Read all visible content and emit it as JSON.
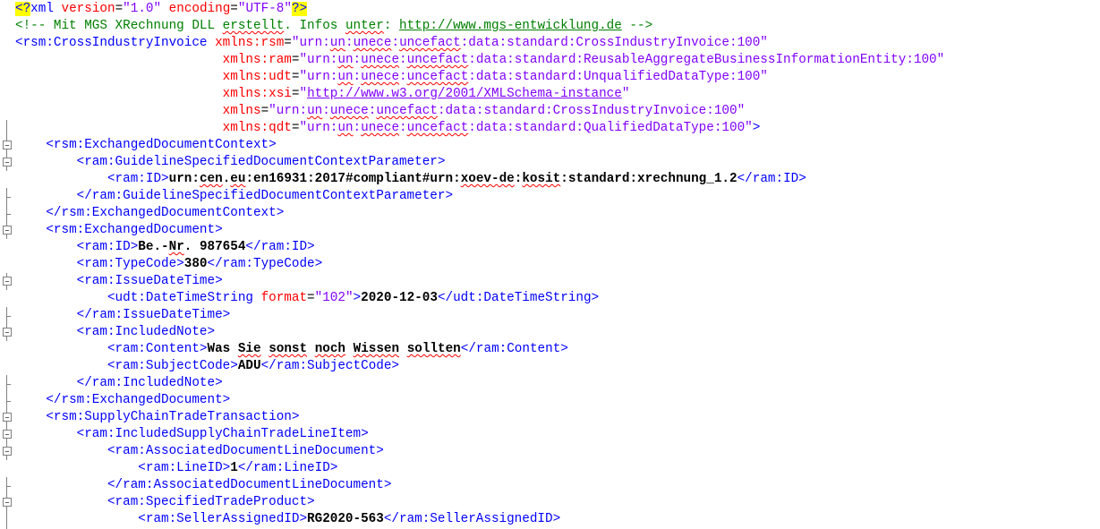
{
  "editor": {
    "language": "xml",
    "colors": {
      "tag": "#0000ff",
      "attribute": "#ff0000",
      "attribute_value": "#8000ff",
      "text": "#000000",
      "comment": "#008000",
      "processing_instruction_highlight": "#ffff00"
    },
    "lines": [
      {
        "indent": "",
        "segs": [
          {
            "t": "<?",
            "c": "c-bracket pi-hl"
          },
          {
            "t": "xml ",
            "c": "c-tag"
          },
          {
            "t": "version",
            "c": "c-attr"
          },
          {
            "t": "=",
            "c": "c-eq"
          },
          {
            "t": "\"1.0\"",
            "c": "c-str"
          },
          {
            "t": " ",
            "c": "c-plain"
          },
          {
            "t": "encoding",
            "c": "c-attr"
          },
          {
            "t": "=",
            "c": "c-eq"
          },
          {
            "t": "\"UTF-8\"",
            "c": "c-str"
          },
          {
            "t": "?>",
            "c": "c-bracket pi-hl"
          }
        ]
      },
      {
        "indent": "",
        "segs": [
          {
            "t": "<!-- Mit MGS XRechnung DLL ",
            "c": "c-comment"
          },
          {
            "t": "erstellt",
            "c": "c-comment sq"
          },
          {
            "t": ". Infos ",
            "c": "c-comment"
          },
          {
            "t": "unter",
            "c": "c-comment sq"
          },
          {
            "t": ": ",
            "c": "c-comment"
          },
          {
            "t": "http://www.mgs-entwicklung.de",
            "c": "c-comment link"
          },
          {
            "t": " -->",
            "c": "c-comment"
          }
        ]
      },
      {
        "indent": "",
        "segs": [
          {
            "t": "<rsm:CrossIndustryInvoice ",
            "c": "c-tag"
          },
          {
            "t": "xmlns:rsm",
            "c": "c-attr"
          },
          {
            "t": "=",
            "c": "c-eq"
          },
          {
            "t": "\"urn:",
            "c": "c-str"
          },
          {
            "t": "un",
            "c": "c-str sq"
          },
          {
            "t": ":",
            "c": "c-str"
          },
          {
            "t": "unece",
            "c": "c-str sq"
          },
          {
            "t": ":",
            "c": "c-str"
          },
          {
            "t": "uncefact",
            "c": "c-str sq"
          },
          {
            "t": ":data:standard:CrossIndustryInvoice:100\"",
            "c": "c-str"
          }
        ]
      },
      {
        "indent": "                           ",
        "segs": [
          {
            "t": "xmlns:ram",
            "c": "c-attr"
          },
          {
            "t": "=",
            "c": "c-eq"
          },
          {
            "t": "\"urn:",
            "c": "c-str"
          },
          {
            "t": "un",
            "c": "c-str sq"
          },
          {
            "t": ":",
            "c": "c-str"
          },
          {
            "t": "unece",
            "c": "c-str sq"
          },
          {
            "t": ":",
            "c": "c-str"
          },
          {
            "t": "uncefact",
            "c": "c-str sq"
          },
          {
            "t": ":data:standard:ReusableAggregateBusinessInformationEntity:100\"",
            "c": "c-str"
          }
        ]
      },
      {
        "indent": "                           ",
        "segs": [
          {
            "t": "xmlns:udt",
            "c": "c-attr"
          },
          {
            "t": "=",
            "c": "c-eq"
          },
          {
            "t": "\"urn:",
            "c": "c-str"
          },
          {
            "t": "un",
            "c": "c-str sq"
          },
          {
            "t": ":",
            "c": "c-str"
          },
          {
            "t": "unece",
            "c": "c-str sq"
          },
          {
            "t": ":",
            "c": "c-str"
          },
          {
            "t": "uncefact",
            "c": "c-str sq"
          },
          {
            "t": ":data:standard:UnqualifiedDataType:100\"",
            "c": "c-str"
          }
        ]
      },
      {
        "indent": "                           ",
        "segs": [
          {
            "t": "xmlns:xsi",
            "c": "c-attr"
          },
          {
            "t": "=",
            "c": "c-eq"
          },
          {
            "t": "\"",
            "c": "c-str"
          },
          {
            "t": "http://www.w3.org/2001/XMLSchema-instance",
            "c": "c-str link"
          },
          {
            "t": "\"",
            "c": "c-str"
          }
        ]
      },
      {
        "indent": "                           ",
        "segs": [
          {
            "t": "xmlns",
            "c": "c-attr"
          },
          {
            "t": "=",
            "c": "c-eq"
          },
          {
            "t": "\"urn:",
            "c": "c-str"
          },
          {
            "t": "un",
            "c": "c-str sq"
          },
          {
            "t": ":",
            "c": "c-str"
          },
          {
            "t": "unece",
            "c": "c-str sq"
          },
          {
            "t": ":",
            "c": "c-str"
          },
          {
            "t": "uncefact",
            "c": "c-str sq"
          },
          {
            "t": ":data:standard:CrossIndustryInvoice:100\"",
            "c": "c-str"
          }
        ]
      },
      {
        "indent": "                           ",
        "segs": [
          {
            "t": "xmlns:qdt",
            "c": "c-attr"
          },
          {
            "t": "=",
            "c": "c-eq"
          },
          {
            "t": "\"urn:",
            "c": "c-str"
          },
          {
            "t": "un",
            "c": "c-str sq"
          },
          {
            "t": ":",
            "c": "c-str"
          },
          {
            "t": "unece",
            "c": "c-str sq"
          },
          {
            "t": ":",
            "c": "c-str"
          },
          {
            "t": "uncefact",
            "c": "c-str sq"
          },
          {
            "t": ":data:standard:QualifiedDataType:100\"",
            "c": "c-str"
          },
          {
            "t": ">",
            "c": "c-tag"
          }
        ]
      },
      {
        "indent": "    ",
        "segs": [
          {
            "t": "<rsm:ExchangedDocumentContext>",
            "c": "c-tag"
          }
        ]
      },
      {
        "indent": "        ",
        "segs": [
          {
            "t": "<ram:GuidelineSpecifiedDocumentContextParameter>",
            "c": "c-tag"
          }
        ]
      },
      {
        "indent": "            ",
        "segs": [
          {
            "t": "<ram:ID>",
            "c": "c-tag"
          },
          {
            "t": "urn:",
            "c": "c-text"
          },
          {
            "t": "cen",
            "c": "c-text sq"
          },
          {
            "t": ".",
            "c": "c-text"
          },
          {
            "t": "eu",
            "c": "c-text sq"
          },
          {
            "t": ":en16931:2017#compliant#urn:",
            "c": "c-text"
          },
          {
            "t": "xoev-de",
            "c": "c-text sq"
          },
          {
            "t": ":",
            "c": "c-text"
          },
          {
            "t": "kosit",
            "c": "c-text sq"
          },
          {
            "t": ":standard:xrechnung_1.2",
            "c": "c-text"
          },
          {
            "t": "</ram:ID>",
            "c": "c-tag"
          }
        ]
      },
      {
        "indent": "        ",
        "segs": [
          {
            "t": "</ram:GuidelineSpecifiedDocumentContextParameter>",
            "c": "c-tag"
          }
        ]
      },
      {
        "indent": "    ",
        "segs": [
          {
            "t": "</rsm:ExchangedDocumentContext>",
            "c": "c-tag"
          }
        ]
      },
      {
        "indent": "    ",
        "segs": [
          {
            "t": "<rsm:ExchangedDocument>",
            "c": "c-tag"
          }
        ]
      },
      {
        "indent": "        ",
        "segs": [
          {
            "t": "<ram:ID>",
            "c": "c-tag"
          },
          {
            "t": "Be.-",
            "c": "c-text"
          },
          {
            "t": "Nr",
            "c": "c-text sq"
          },
          {
            "t": ". 987654",
            "c": "c-text"
          },
          {
            "t": "</ram:ID>",
            "c": "c-tag"
          }
        ]
      },
      {
        "indent": "        ",
        "segs": [
          {
            "t": "<ram:TypeCode>",
            "c": "c-tag"
          },
          {
            "t": "380",
            "c": "c-text"
          },
          {
            "t": "</ram:TypeCode>",
            "c": "c-tag"
          }
        ]
      },
      {
        "indent": "        ",
        "segs": [
          {
            "t": "<ram:IssueDateTime>",
            "c": "c-tag"
          }
        ]
      },
      {
        "indent": "            ",
        "segs": [
          {
            "t": "<udt:DateTimeString ",
            "c": "c-tag"
          },
          {
            "t": "format",
            "c": "c-attr"
          },
          {
            "t": "=",
            "c": "c-eq"
          },
          {
            "t": "\"102\"",
            "c": "c-str"
          },
          {
            "t": ">",
            "c": "c-tag"
          },
          {
            "t": "2020-12-03",
            "c": "c-text"
          },
          {
            "t": "</udt:DateTimeString>",
            "c": "c-tag"
          }
        ]
      },
      {
        "indent": "        ",
        "segs": [
          {
            "t": "</ram:IssueDateTime>",
            "c": "c-tag"
          }
        ]
      },
      {
        "indent": "        ",
        "segs": [
          {
            "t": "<ram:IncludedNote>",
            "c": "c-tag"
          }
        ]
      },
      {
        "indent": "            ",
        "segs": [
          {
            "t": "<ram:Content>",
            "c": "c-tag"
          },
          {
            "t": "Was ",
            "c": "c-text"
          },
          {
            "t": "Sie",
            "c": "c-text sq"
          },
          {
            "t": " ",
            "c": "c-text"
          },
          {
            "t": "sonst",
            "c": "c-text sq"
          },
          {
            "t": " ",
            "c": "c-text"
          },
          {
            "t": "noch",
            "c": "c-text sq"
          },
          {
            "t": " ",
            "c": "c-text"
          },
          {
            "t": "Wissen",
            "c": "c-text sq"
          },
          {
            "t": " ",
            "c": "c-text"
          },
          {
            "t": "sollten",
            "c": "c-text sq"
          },
          {
            "t": "</ram:Content>",
            "c": "c-tag"
          }
        ]
      },
      {
        "indent": "            ",
        "segs": [
          {
            "t": "<ram:SubjectCode>",
            "c": "c-tag"
          },
          {
            "t": "ADU",
            "c": "c-text"
          },
          {
            "t": "</ram:SubjectCode>",
            "c": "c-tag"
          }
        ]
      },
      {
        "indent": "        ",
        "segs": [
          {
            "t": "</ram:IncludedNote>",
            "c": "c-tag"
          }
        ]
      },
      {
        "indent": "    ",
        "segs": [
          {
            "t": "</rsm:ExchangedDocument>",
            "c": "c-tag"
          }
        ]
      },
      {
        "indent": "    ",
        "segs": [
          {
            "t": "<rsm:SupplyChainTradeTransaction>",
            "c": "c-tag"
          }
        ]
      },
      {
        "indent": "        ",
        "segs": [
          {
            "t": "<ram:IncludedSupplyChainTradeLineItem>",
            "c": "c-tag"
          }
        ]
      },
      {
        "indent": "            ",
        "segs": [
          {
            "t": "<ram:AssociatedDocumentLineDocument>",
            "c": "c-tag"
          }
        ]
      },
      {
        "indent": "                ",
        "segs": [
          {
            "t": "<ram:LineID>",
            "c": "c-tag"
          },
          {
            "t": "1",
            "c": "c-text"
          },
          {
            "t": "</ram:LineID>",
            "c": "c-tag"
          }
        ]
      },
      {
        "indent": "            ",
        "segs": [
          {
            "t": "</ram:AssociatedDocumentLineDocument>",
            "c": "c-tag"
          }
        ]
      },
      {
        "indent": "            ",
        "segs": [
          {
            "t": "<ram:SpecifiedTradeProduct>",
            "c": "c-tag"
          }
        ]
      },
      {
        "indent": "                ",
        "segs": [
          {
            "t": "<ram:SellerAssignedID>",
            "c": "c-tag"
          },
          {
            "t": "RG2020-563",
            "c": "c-text"
          },
          {
            "t": "</ram:SellerAssignedID>",
            "c": "c-tag"
          }
        ]
      }
    ],
    "fold_markers": [
      {
        "line": 7,
        "type": "guide"
      },
      {
        "line": 8,
        "type": "box"
      },
      {
        "line": 9,
        "type": "box"
      },
      {
        "line": 11,
        "type": "end"
      },
      {
        "line": 12,
        "type": "end"
      },
      {
        "line": 13,
        "type": "box"
      },
      {
        "line": 16,
        "type": "box"
      },
      {
        "line": 18,
        "type": "end"
      },
      {
        "line": 19,
        "type": "box"
      },
      {
        "line": 22,
        "type": "end"
      },
      {
        "line": 23,
        "type": "end"
      },
      {
        "line": 24,
        "type": "box"
      },
      {
        "line": 25,
        "type": "box"
      },
      {
        "line": 26,
        "type": "box"
      },
      {
        "line": 28,
        "type": "end"
      },
      {
        "line": 29,
        "type": "box"
      }
    ]
  }
}
